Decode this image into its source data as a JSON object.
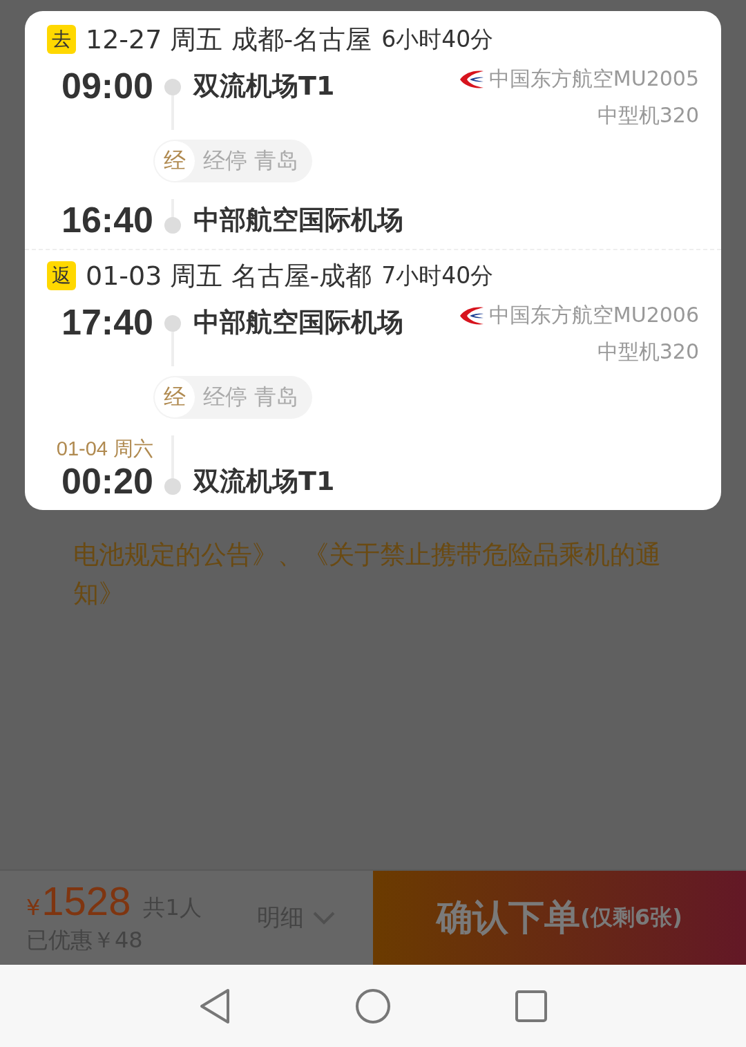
{
  "legs": [
    {
      "badge": "去",
      "date": "12-27 周五",
      "route": "成都-名古屋",
      "duration": "6小时40分",
      "departure": {
        "time": "09:00",
        "airport": "双流机场T1"
      },
      "airline": "中国东方航空MU2005",
      "aircraft": "中型机320",
      "stop": {
        "badge": "经",
        "text": "经停 青岛"
      },
      "arrival": {
        "time": "16:40",
        "airport": "中部航空国际机场"
      }
    },
    {
      "badge": "返",
      "date": "01-03 周五",
      "route": "名古屋-成都",
      "duration": "7小时40分",
      "departure": {
        "time": "17:40",
        "airport": "中部航空国际机场"
      },
      "airline": "中国东方航空MU2006",
      "aircraft": "中型机320",
      "stop": {
        "badge": "经",
        "text": "经停 青岛"
      },
      "arrival": {
        "date": "01-04 周六",
        "time": "00:20",
        "airport": "双流机场T1"
      }
    }
  ],
  "notice": "电池规定的公告》、《关于禁止携带危险品乘机的通知》",
  "bottom_bar": {
    "currency": "¥",
    "price": "1528",
    "passengers": "共1人",
    "discount": "已优惠￥48",
    "details": "明细",
    "confirm": "确认下单",
    "remaining": "(仅剩6张)"
  }
}
